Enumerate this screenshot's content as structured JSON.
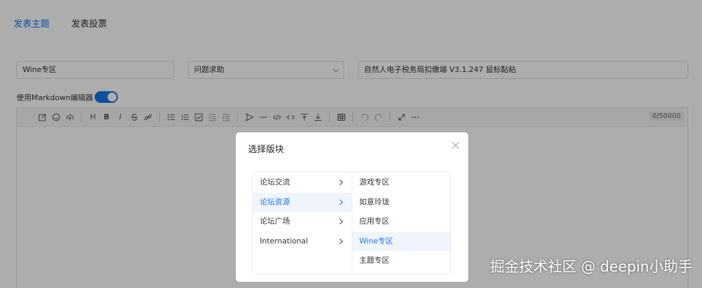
{
  "tabs": [
    "发表主题",
    "发表投票"
  ],
  "form": {
    "section_value": "Wine专区",
    "category_value": "问题求助",
    "title_value": "自然人电子税务局扣缴端 V3.1.247 鼠标黏粘"
  },
  "markdown_toggle": {
    "label": "使用Markdown编辑器",
    "enabled": true
  },
  "toolbar": {
    "icons": [
      "edit-icon",
      "emoji-icon",
      "upload-icon",
      "heading-icon",
      "bold-icon",
      "italic-icon",
      "strikethrough-icon",
      "link-icon",
      "unordered-list-icon",
      "ordered-list-icon",
      "checklist-icon",
      "outdent-icon",
      "indent-icon",
      "quote-icon",
      "line-icon",
      "code-icon",
      "inline-code-icon",
      "insert-before-icon",
      "insert-after-icon",
      "table-icon",
      "undo-icon",
      "redo-icon",
      "fullscreen-icon",
      "more-icon"
    ],
    "heading_glyph": "H",
    "bold_glyph": "B",
    "italic_glyph": "I",
    "counter": "0/50000"
  },
  "modal": {
    "title": "选择版块",
    "columns": [
      [
        "论坛交流",
        "论坛资源",
        "论坛广场",
        "International"
      ],
      [
        "游戏专区",
        "如意玲珑",
        "应用专区",
        "Wine专区",
        "主题专区"
      ]
    ]
  },
  "watermark": "掘金技术社区 @ deepin小助手",
  "colors": {
    "accent": "#1a73e8",
    "overlay": "rgba(0,0,0,0.32)"
  }
}
